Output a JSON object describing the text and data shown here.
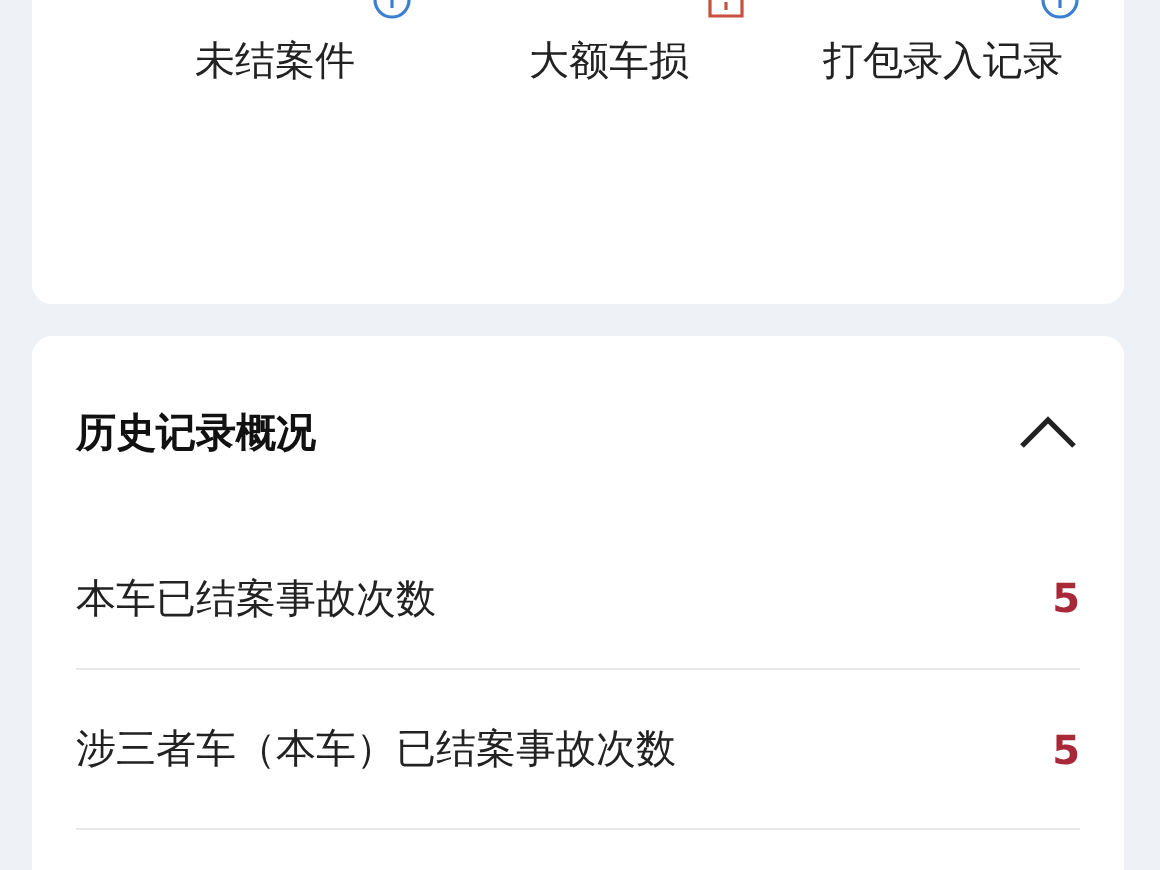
{
  "shortcuts": [
    {
      "label": "未结案件",
      "kind": "info"
    },
    {
      "label": "大额车损",
      "kind": "warning"
    },
    {
      "label": "打包录入记录",
      "kind": "info"
    }
  ],
  "history": {
    "title": "历史记录概况",
    "expanded": true,
    "rows": [
      {
        "label": "本车已结案事故次数",
        "value": "5"
      },
      {
        "label": "涉三者车（本车）已结案事故次数",
        "value": "5"
      }
    ]
  }
}
